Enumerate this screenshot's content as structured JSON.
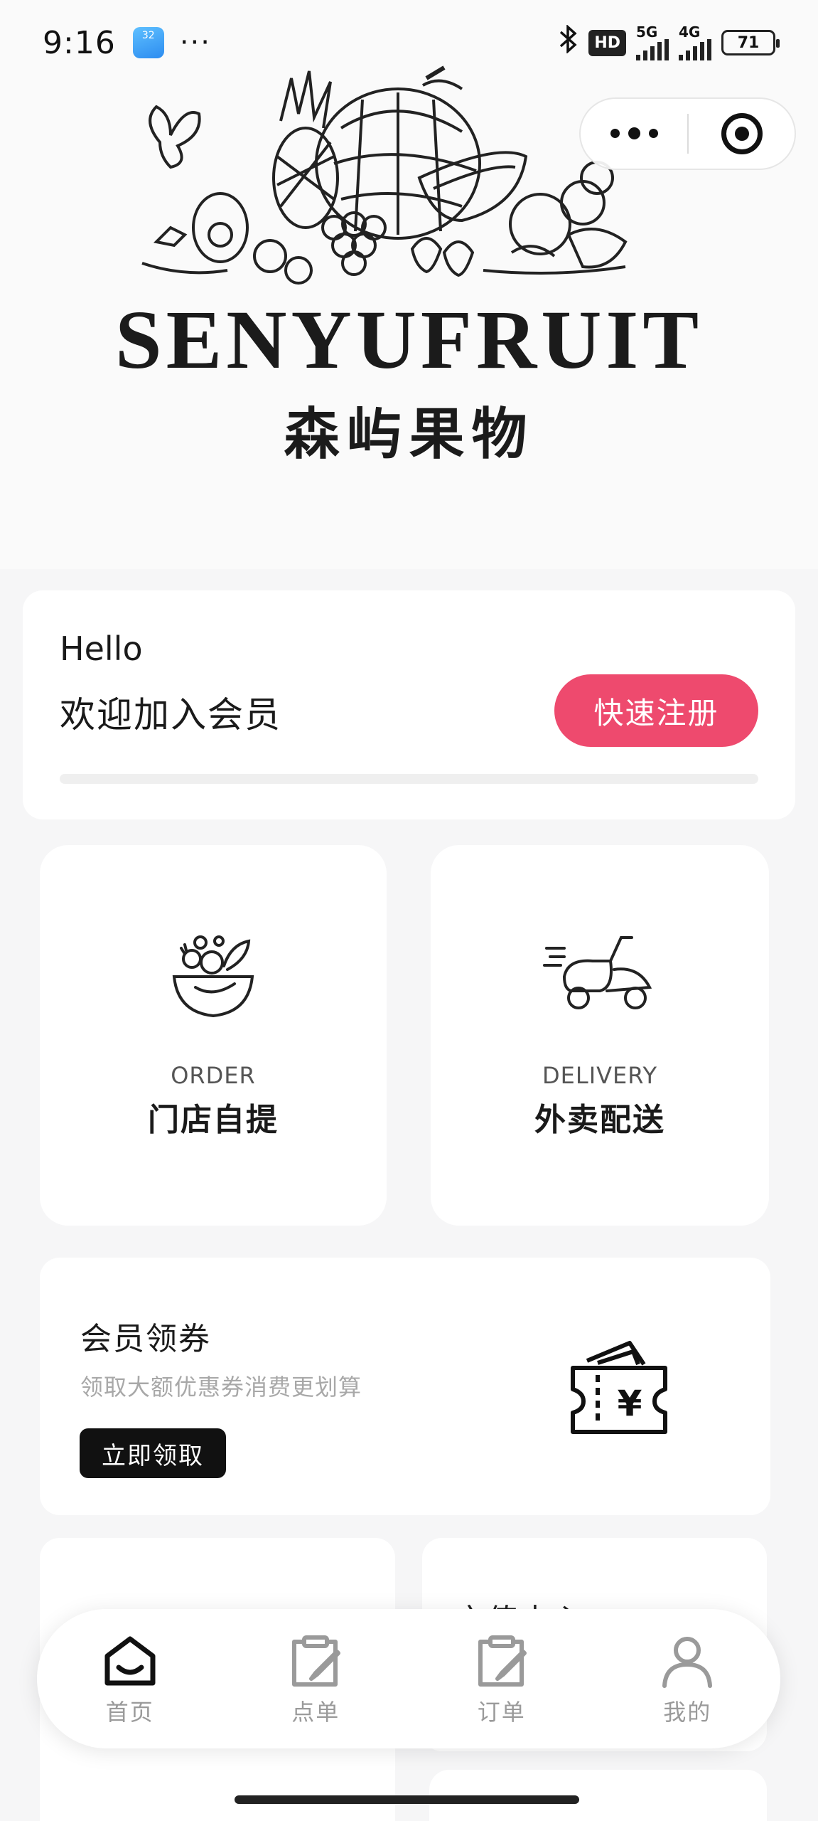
{
  "status_bar": {
    "time": "9:16",
    "app_badge": "32",
    "more": "···",
    "hd": "HD",
    "net1": "5G",
    "net2": "4G",
    "battery": "71"
  },
  "brand": {
    "name_en": "SENYUFRUIT",
    "name_cn": "森屿果物"
  },
  "member": {
    "hello": "Hello",
    "welcome": "欢迎加入会员",
    "register_label": "快速注册",
    "progress": 0
  },
  "features": {
    "order": {
      "en": "ORDER",
      "cn": "门店自提",
      "icon": "fruit-bowl-icon"
    },
    "delivery": {
      "en": "DELIVERY",
      "cn": "外卖配送",
      "icon": "scooter-icon"
    }
  },
  "coupon": {
    "title": "会员领券",
    "subtitle": "领取大额优惠券消费更划算",
    "button": "立即领取",
    "icon": "coupon-ticket-icon"
  },
  "lower": {
    "right_title": "充值中心"
  },
  "tabs": [
    {
      "label": "首页",
      "icon": "home-icon",
      "active": true
    },
    {
      "label": "点单",
      "icon": "order-edit-icon",
      "active": false
    },
    {
      "label": "订单",
      "icon": "orders-edit-icon",
      "active": false
    },
    {
      "label": "我的",
      "icon": "user-icon",
      "active": false
    }
  ],
  "colors": {
    "accent": "#ee4a6e",
    "dark": "#111111",
    "background": "#f6f6f7"
  }
}
